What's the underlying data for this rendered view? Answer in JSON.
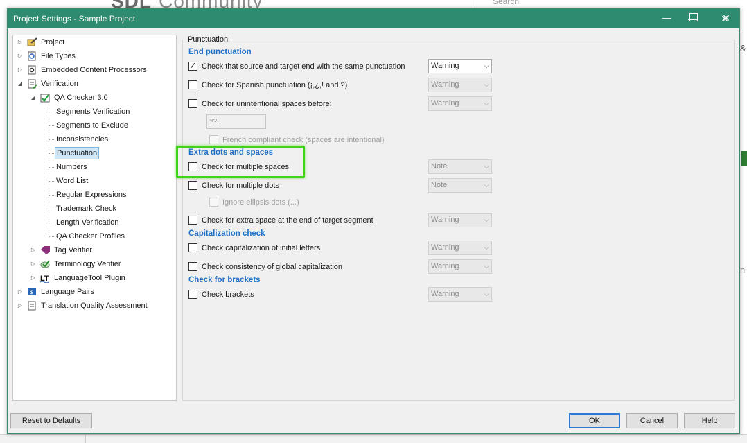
{
  "background": {
    "logo_bold": "SDL",
    "logo_light": "Community",
    "search_placeholder": "Search",
    "right_text": "&",
    "right_text2": "n"
  },
  "dialog": {
    "title": "Project Settings - Sample Project",
    "window_buttons": {
      "minimize": "—",
      "maximize": "☐",
      "close": "✕"
    }
  },
  "tree": {
    "items": [
      {
        "label": "Project",
        "level": 0,
        "expander": true,
        "icon": "project-icon"
      },
      {
        "label": "File Types",
        "level": 0,
        "expander": true,
        "icon": "file-types-icon"
      },
      {
        "label": "Embedded Content Processors",
        "level": 0,
        "expander": true,
        "icon": "gear-icon"
      },
      {
        "label": "Verification",
        "level": 0,
        "expander": true,
        "icon": "verification-icon"
      },
      {
        "label": "QA Checker 3.0",
        "level": 1,
        "expander": true,
        "icon": "qa-checker-icon"
      },
      {
        "label": "Segments Verification",
        "level": 2
      },
      {
        "label": "Segments to Exclude",
        "level": 2
      },
      {
        "label": "Inconsistencies",
        "level": 2
      },
      {
        "label": "Punctuation",
        "level": 2,
        "selected": true
      },
      {
        "label": "Numbers",
        "level": 2
      },
      {
        "label": "Word List",
        "level": 2
      },
      {
        "label": "Regular Expressions",
        "level": 2
      },
      {
        "label": "Trademark Check",
        "level": 2
      },
      {
        "label": "Length Verification",
        "level": 2
      },
      {
        "label": "QA Checker Profiles",
        "level": 2
      },
      {
        "label": "Tag Verifier",
        "level": 1,
        "expander": true,
        "icon": "tag-verifier-icon"
      },
      {
        "label": "Terminology Verifier",
        "level": 1,
        "expander": true,
        "icon": "terminology-verifier-icon"
      },
      {
        "label": "LanguageTool Plugin",
        "level": 1,
        "expander": true,
        "icon": "languagetool-icon"
      },
      {
        "label": "Language Pairs",
        "level": 0,
        "expander": true,
        "icon": "language-pairs-icon"
      },
      {
        "label": "Translation Quality Assessment",
        "level": 0,
        "expander": true,
        "icon": "tqa-icon"
      }
    ]
  },
  "panel": {
    "title": "Punctuation",
    "sections": {
      "end_punctuation": "End punctuation",
      "extra_dots": "Extra dots and spaces",
      "capitalization": "Capitalization check",
      "brackets": "Check for brackets"
    },
    "options": {
      "same_punctuation": {
        "label": "Check that source and target end with the same punctuation",
        "checked": true,
        "severity": "Warning",
        "enabled": true
      },
      "spanish_punctuation": {
        "label": "Check for Spanish punctuation (¡,¿,! and ?)",
        "checked": false,
        "severity": "Warning",
        "enabled": false
      },
      "unintentional_spaces": {
        "label": "Check for unintentional spaces before:",
        "checked": false,
        "severity": "Warning",
        "enabled": false
      },
      "unintentional_chars": ":!?;",
      "french_compliant": {
        "label": "French compliant check (spaces are intentional)",
        "checked": false
      },
      "multiple_spaces": {
        "label": "Check for multiple spaces",
        "checked": false,
        "severity": "Note",
        "enabled": false
      },
      "multiple_dots": {
        "label": "Check for multiple dots",
        "checked": false,
        "severity": "Note",
        "enabled": false
      },
      "ignore_ellipsis": {
        "label": "Ignore ellipsis dots (...)",
        "checked": false
      },
      "extra_space_end": {
        "label": "Check for extra space at the end of target segment",
        "checked": false,
        "severity": "Warning",
        "enabled": false
      },
      "cap_initial": {
        "label": "Check capitalization of initial letters",
        "checked": false,
        "severity": "Warning",
        "enabled": false
      },
      "cap_global": {
        "label": "Check consistency of global capitalization",
        "checked": false,
        "severity": "Warning",
        "enabled": false
      },
      "brackets": {
        "label": "Check brackets",
        "checked": false,
        "severity": "Warning",
        "enabled": false
      }
    }
  },
  "buttons": {
    "reset": "Reset to Defaults",
    "ok": "OK",
    "cancel": "Cancel",
    "help": "Help"
  },
  "colors": {
    "titlebar": "#2f8b6f",
    "section_heading": "#1f6fc4",
    "highlight": "#42d21a",
    "selection": "#cfe6f7"
  }
}
